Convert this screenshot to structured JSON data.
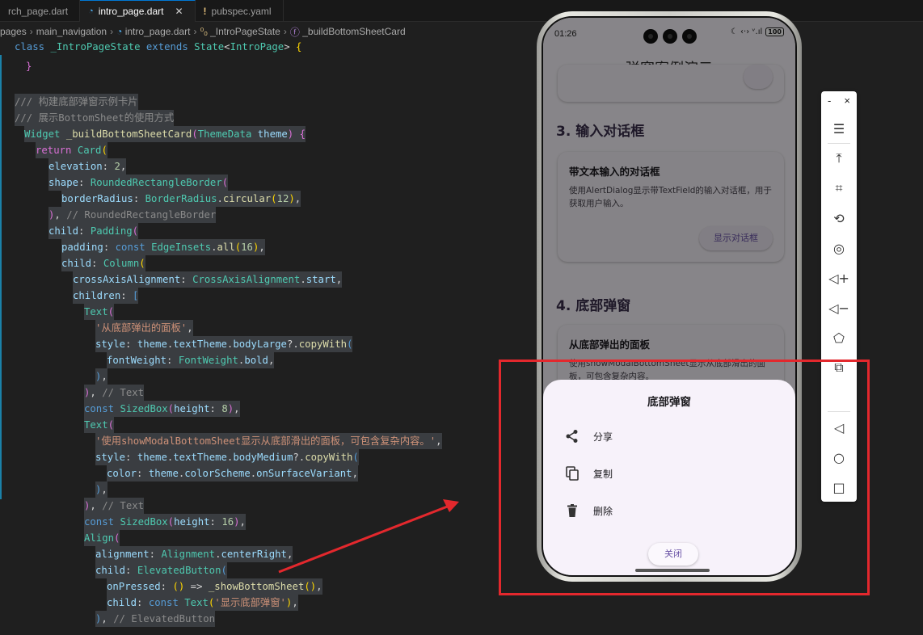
{
  "editor": {
    "tabs": [
      {
        "label": "rch_page.dart"
      },
      {
        "label": "intro_page.dart"
      },
      {
        "label": "pubspec.yaml"
      }
    ],
    "breadcrumb": {
      "p1": "pages",
      "p2": "main_navigation",
      "p3": "intro_page.dart",
      "p4": "_IntroPageState",
      "p5": "_buildBottomSheetCard"
    },
    "sticky_line": "class _IntroPageState extends State<IntroPage> {",
    "code": [
      "}",
      "",
      "/// 构建底部弹窗示例卡片",
      "/// 展示BottomSheet的使用方式",
      "Widget _buildBottomSheetCard(ThemeData theme) {",
      "  return Card(",
      "    elevation: 2,",
      "    shape: RoundedRectangleBorder(",
      "      borderRadius: BorderRadius.circular(12),",
      "    ), // RoundedRectangleBorder",
      "    child: Padding(",
      "      padding: const EdgeInsets.all(16),",
      "      child: Column(",
      "        crossAxisAlignment: CrossAxisAlignment.start,",
      "        children: [",
      "          Text(",
      "            '从底部弹出的面板',",
      "            style: theme.textTheme.bodyLarge?.copyWith(",
      "              fontWeight: FontWeight.bold,",
      "            ),",
      "          ), // Text",
      "          const SizedBox(height: 8),",
      "          Text(",
      "            '使用showModalBottomSheet显示从底部滑出的面板，可包含复杂内容。',",
      "            style: theme.textTheme.bodyMedium?.copyWith(",
      "              color: theme.colorScheme.onSurfaceVariant,",
      "            ),",
      "          ), // Text",
      "          const SizedBox(height: 16),",
      "          Align(",
      "            alignment: Alignment.centerRight,",
      "            child: ElevatedButton(",
      "              onPressed: () => _showBottomSheet(),",
      "              child: const Text('显示底部弹窗'),",
      "            ), // ElevatedButton"
    ]
  },
  "phone": {
    "status": {
      "time": "01:26",
      "battery": "100",
      "icons": "☾ ‹·› ᵛ.ıl"
    },
    "appbar_title": "弹窗案例演示",
    "section3_title": "3. 输入对话框",
    "card3": {
      "title": "带文本输入的对话框",
      "desc": "使用AlertDialog显示带TextField的输入对话框，用于获取用户输入。",
      "button": "显示对话框"
    },
    "section4_title": "4. 底部弹窗",
    "card4": {
      "title": "从底部弹出的面板",
      "desc": "使用showModalBottomSheet显示从底部滑出的面板，可包含复杂内容。"
    },
    "sheet": {
      "title": "底部弹窗",
      "items": [
        {
          "label": "分享",
          "icon": "share-icon"
        },
        {
          "label": "复制",
          "icon": "copy-icon"
        },
        {
          "label": "删除",
          "icon": "delete-icon"
        }
      ],
      "close": "关闭"
    }
  },
  "toolbar": {
    "minimize": "-",
    "close": "×"
  },
  "colors": {
    "annotation": "#e3282d",
    "accent": "#6750a4"
  }
}
